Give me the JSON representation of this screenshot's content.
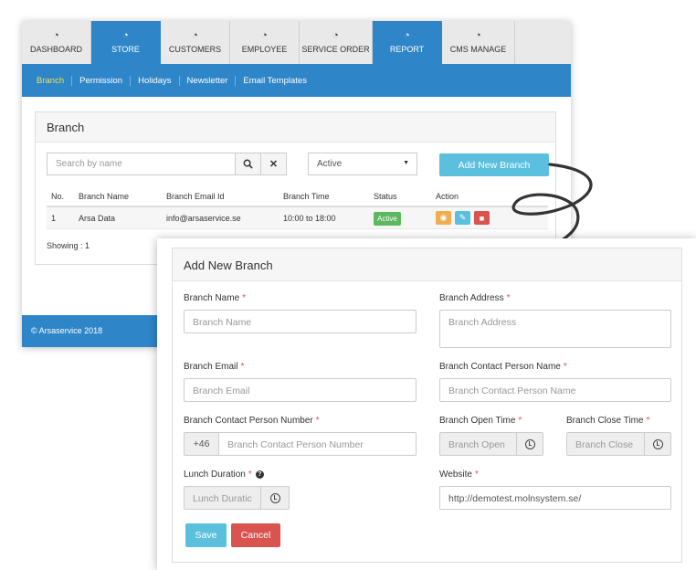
{
  "nav": {
    "tabs": [
      {
        "label": "DASHBOARD",
        "icon": "dashboard-icon"
      },
      {
        "label": "STORE",
        "icon": "dashboard-icon",
        "active": true
      },
      {
        "label": "CUSTOMERS",
        "icon": "dashboard-icon"
      },
      {
        "label": "EMPLOYEE",
        "icon": "dashboard-icon"
      },
      {
        "label": "SERVICE ORDER",
        "icon": "dashboard-icon"
      },
      {
        "label": "REPORT",
        "icon": "dashboard-icon",
        "active": true
      },
      {
        "label": "CMS MANAGE",
        "icon": "dashboard-icon"
      }
    ]
  },
  "subnav": {
    "items": [
      "Branch",
      "Permission",
      "Holidays",
      "Newsletter",
      "Email Templates"
    ]
  },
  "branch_panel": {
    "title": "Branch",
    "search_placeholder": "Search by name",
    "status_value": "Active",
    "add_button": "Add New Branch",
    "columns": [
      "No.",
      "Branch Name",
      "Branch Email Id",
      "Branch Time",
      "Status",
      "Action"
    ],
    "rows": [
      {
        "no": "1",
        "name": "Arsa Data",
        "email": "info@arsaservice.se",
        "time": "10:00 to 18:00",
        "status": "Active"
      }
    ],
    "showing": "Showing : 1"
  },
  "footer": {
    "text": "© Arsaservice 2018"
  },
  "form": {
    "title": "Add New Branch",
    "branch_name": {
      "label": "Branch Name",
      "placeholder": "Branch Name"
    },
    "branch_address": {
      "label": "Branch Address",
      "placeholder": "Branch Address"
    },
    "branch_email": {
      "label": "Branch Email",
      "placeholder": "Branch Email"
    },
    "contact_name": {
      "label": "Branch Contact Person Name",
      "placeholder": "Branch Contact Person Name"
    },
    "contact_number": {
      "label": "Branch Contact Person Number",
      "prefix": "+46",
      "placeholder": "Branch Contact Person Number"
    },
    "open_time": {
      "label": "Branch Open Time",
      "placeholder": "Branch Open"
    },
    "close_time": {
      "label": "Branch Close Time",
      "placeholder": "Branch Close"
    },
    "lunch": {
      "label": "Lunch Duration",
      "placeholder": "Lunch Duratic"
    },
    "website": {
      "label": "Website",
      "value": "http://demotest.molnsystem.se/"
    },
    "required_mark": "*",
    "save": "Save",
    "cancel": "Cancel"
  },
  "colors": {
    "primary": "#2e86c9",
    "info": "#5bc0de",
    "success": "#5cb85c",
    "warning": "#f0ad4e",
    "danger": "#d9534f"
  }
}
